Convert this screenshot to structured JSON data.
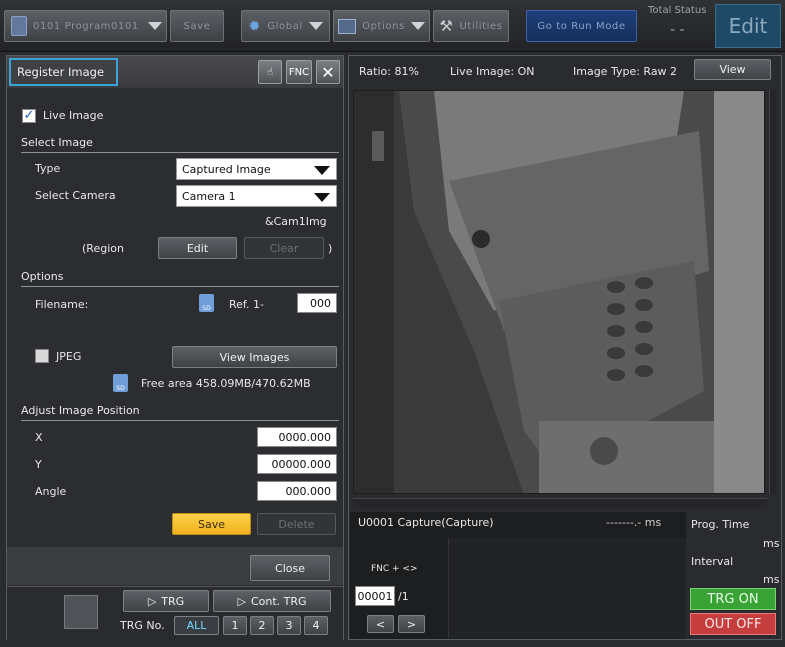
{
  "toolbar": {
    "program": "0101  Program0101",
    "save": "Save",
    "global": "Global",
    "options": "Options",
    "utilities": "Utilities",
    "run_mode": "Go to Run Mode",
    "total_status_label": "Total Status",
    "total_status_value": "- -",
    "edit": "Edit"
  },
  "panel": {
    "title": "Register Image",
    "fnc": "FNC",
    "live_image_label": "Live Image",
    "select_image_header": "Select Image",
    "type_label": "Type",
    "type_value": "Captured Image",
    "camera_label": "Select Camera",
    "camera_value": "Camera 1",
    "cam_var": "&Cam1Img",
    "region_label": "(Region",
    "region_close": ")",
    "edit_btn": "Edit",
    "clear_btn": "Clear",
    "options_header": "Options",
    "filename_label": "Filename:",
    "ref_label": "Ref.  1-",
    "ref_value": "000",
    "jpeg_label": "JPEG",
    "view_images_btn": "View Images",
    "free_area": "Free area 458.09MB/470.62MB",
    "adjust_header": "Adjust Image Position",
    "x_label": "X",
    "x_value": "0000.000",
    "y_label": "Y",
    "y_value": "00000.000",
    "angle_label": "Angle",
    "angle_value": "000.000",
    "save_btn": "Save",
    "delete_btn": "Delete",
    "close_btn": "Close",
    "trg_btn": "TRG",
    "cont_trg_btn": "Cont. TRG",
    "trg_no_label": "TRG No.",
    "trg_no_all": "ALL",
    "trg_nums": [
      "1",
      "2",
      "3",
      "4"
    ]
  },
  "image_panel": {
    "ratio": "Ratio: 81%",
    "live": "Live Image: ON",
    "image_type": "Image Type: Raw 2",
    "view_btn": "View"
  },
  "results": {
    "unit": "U0001  Capture(Capture)",
    "time": "-------.- ms",
    "fnc_label": "FNC + <>",
    "counter_value": "00001",
    "counter_total": "/1",
    "prev": "<",
    "next": ">",
    "prog_time_label": "Prog. Time",
    "ms1": "ms",
    "interval_label": "Interval",
    "ms2": "ms",
    "trg_on": "TRG ON",
    "out_off": "OUT OFF"
  }
}
